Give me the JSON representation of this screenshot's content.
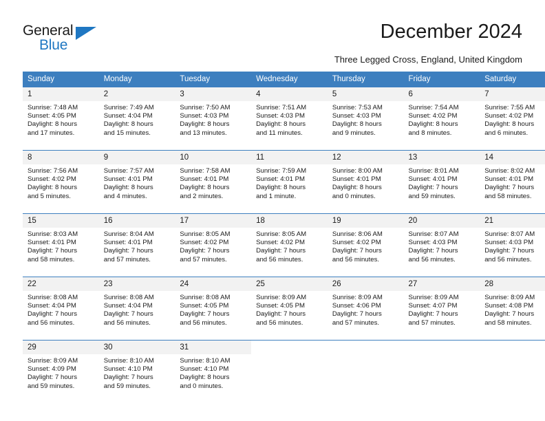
{
  "brand": {
    "name_top": "General",
    "name_bottom": "Blue",
    "accent_color": "#1f77c2"
  },
  "header": {
    "title": "December 2024",
    "subtitle": "Three Legged Cross, England, United Kingdom"
  },
  "theme": {
    "header_bg": "#3d7fbf",
    "header_text": "#ffffff",
    "daynum_bg": "#f2f2f2",
    "cell_bg": "#ffffff",
    "text": "#1a1a1a"
  },
  "weekdays": [
    "Sunday",
    "Monday",
    "Tuesday",
    "Wednesday",
    "Thursday",
    "Friday",
    "Saturday"
  ],
  "weeks": [
    [
      {
        "day": "1",
        "sunrise": "Sunrise: 7:48 AM",
        "sunset": "Sunset: 4:05 PM",
        "daylight_line1": "Daylight: 8 hours",
        "daylight_line2": "and 17 minutes."
      },
      {
        "day": "2",
        "sunrise": "Sunrise: 7:49 AM",
        "sunset": "Sunset: 4:04 PM",
        "daylight_line1": "Daylight: 8 hours",
        "daylight_line2": "and 15 minutes."
      },
      {
        "day": "3",
        "sunrise": "Sunrise: 7:50 AM",
        "sunset": "Sunset: 4:03 PM",
        "daylight_line1": "Daylight: 8 hours",
        "daylight_line2": "and 13 minutes."
      },
      {
        "day": "4",
        "sunrise": "Sunrise: 7:51 AM",
        "sunset": "Sunset: 4:03 PM",
        "daylight_line1": "Daylight: 8 hours",
        "daylight_line2": "and 11 minutes."
      },
      {
        "day": "5",
        "sunrise": "Sunrise: 7:53 AM",
        "sunset": "Sunset: 4:03 PM",
        "daylight_line1": "Daylight: 8 hours",
        "daylight_line2": "and 9 minutes."
      },
      {
        "day": "6",
        "sunrise": "Sunrise: 7:54 AM",
        "sunset": "Sunset: 4:02 PM",
        "daylight_line1": "Daylight: 8 hours",
        "daylight_line2": "and 8 minutes."
      },
      {
        "day": "7",
        "sunrise": "Sunrise: 7:55 AM",
        "sunset": "Sunset: 4:02 PM",
        "daylight_line1": "Daylight: 8 hours",
        "daylight_line2": "and 6 minutes."
      }
    ],
    [
      {
        "day": "8",
        "sunrise": "Sunrise: 7:56 AM",
        "sunset": "Sunset: 4:02 PM",
        "daylight_line1": "Daylight: 8 hours",
        "daylight_line2": "and 5 minutes."
      },
      {
        "day": "9",
        "sunrise": "Sunrise: 7:57 AM",
        "sunset": "Sunset: 4:01 PM",
        "daylight_line1": "Daylight: 8 hours",
        "daylight_line2": "and 4 minutes."
      },
      {
        "day": "10",
        "sunrise": "Sunrise: 7:58 AM",
        "sunset": "Sunset: 4:01 PM",
        "daylight_line1": "Daylight: 8 hours",
        "daylight_line2": "and 2 minutes."
      },
      {
        "day": "11",
        "sunrise": "Sunrise: 7:59 AM",
        "sunset": "Sunset: 4:01 PM",
        "daylight_line1": "Daylight: 8 hours",
        "daylight_line2": "and 1 minute."
      },
      {
        "day": "12",
        "sunrise": "Sunrise: 8:00 AM",
        "sunset": "Sunset: 4:01 PM",
        "daylight_line1": "Daylight: 8 hours",
        "daylight_line2": "and 0 minutes."
      },
      {
        "day": "13",
        "sunrise": "Sunrise: 8:01 AM",
        "sunset": "Sunset: 4:01 PM",
        "daylight_line1": "Daylight: 7 hours",
        "daylight_line2": "and 59 minutes."
      },
      {
        "day": "14",
        "sunrise": "Sunrise: 8:02 AM",
        "sunset": "Sunset: 4:01 PM",
        "daylight_line1": "Daylight: 7 hours",
        "daylight_line2": "and 58 minutes."
      }
    ],
    [
      {
        "day": "15",
        "sunrise": "Sunrise: 8:03 AM",
        "sunset": "Sunset: 4:01 PM",
        "daylight_line1": "Daylight: 7 hours",
        "daylight_line2": "and 58 minutes."
      },
      {
        "day": "16",
        "sunrise": "Sunrise: 8:04 AM",
        "sunset": "Sunset: 4:01 PM",
        "daylight_line1": "Daylight: 7 hours",
        "daylight_line2": "and 57 minutes."
      },
      {
        "day": "17",
        "sunrise": "Sunrise: 8:05 AM",
        "sunset": "Sunset: 4:02 PM",
        "daylight_line1": "Daylight: 7 hours",
        "daylight_line2": "and 57 minutes."
      },
      {
        "day": "18",
        "sunrise": "Sunrise: 8:05 AM",
        "sunset": "Sunset: 4:02 PM",
        "daylight_line1": "Daylight: 7 hours",
        "daylight_line2": "and 56 minutes."
      },
      {
        "day": "19",
        "sunrise": "Sunrise: 8:06 AM",
        "sunset": "Sunset: 4:02 PM",
        "daylight_line1": "Daylight: 7 hours",
        "daylight_line2": "and 56 minutes."
      },
      {
        "day": "20",
        "sunrise": "Sunrise: 8:07 AM",
        "sunset": "Sunset: 4:03 PM",
        "daylight_line1": "Daylight: 7 hours",
        "daylight_line2": "and 56 minutes."
      },
      {
        "day": "21",
        "sunrise": "Sunrise: 8:07 AM",
        "sunset": "Sunset: 4:03 PM",
        "daylight_line1": "Daylight: 7 hours",
        "daylight_line2": "and 56 minutes."
      }
    ],
    [
      {
        "day": "22",
        "sunrise": "Sunrise: 8:08 AM",
        "sunset": "Sunset: 4:04 PM",
        "daylight_line1": "Daylight: 7 hours",
        "daylight_line2": "and 56 minutes."
      },
      {
        "day": "23",
        "sunrise": "Sunrise: 8:08 AM",
        "sunset": "Sunset: 4:04 PM",
        "daylight_line1": "Daylight: 7 hours",
        "daylight_line2": "and 56 minutes."
      },
      {
        "day": "24",
        "sunrise": "Sunrise: 8:08 AM",
        "sunset": "Sunset: 4:05 PM",
        "daylight_line1": "Daylight: 7 hours",
        "daylight_line2": "and 56 minutes."
      },
      {
        "day": "25",
        "sunrise": "Sunrise: 8:09 AM",
        "sunset": "Sunset: 4:05 PM",
        "daylight_line1": "Daylight: 7 hours",
        "daylight_line2": "and 56 minutes."
      },
      {
        "day": "26",
        "sunrise": "Sunrise: 8:09 AM",
        "sunset": "Sunset: 4:06 PM",
        "daylight_line1": "Daylight: 7 hours",
        "daylight_line2": "and 57 minutes."
      },
      {
        "day": "27",
        "sunrise": "Sunrise: 8:09 AM",
        "sunset": "Sunset: 4:07 PM",
        "daylight_line1": "Daylight: 7 hours",
        "daylight_line2": "and 57 minutes."
      },
      {
        "day": "28",
        "sunrise": "Sunrise: 8:09 AM",
        "sunset": "Sunset: 4:08 PM",
        "daylight_line1": "Daylight: 7 hours",
        "daylight_line2": "and 58 minutes."
      }
    ],
    [
      {
        "day": "29",
        "sunrise": "Sunrise: 8:09 AM",
        "sunset": "Sunset: 4:09 PM",
        "daylight_line1": "Daylight: 7 hours",
        "daylight_line2": "and 59 minutes."
      },
      {
        "day": "30",
        "sunrise": "Sunrise: 8:10 AM",
        "sunset": "Sunset: 4:10 PM",
        "daylight_line1": "Daylight: 7 hours",
        "daylight_line2": "and 59 minutes."
      },
      {
        "day": "31",
        "sunrise": "Sunrise: 8:10 AM",
        "sunset": "Sunset: 4:10 PM",
        "daylight_line1": "Daylight: 8 hours",
        "daylight_line2": "and 0 minutes."
      },
      {
        "day": "",
        "sunrise": "",
        "sunset": "",
        "daylight_line1": "",
        "daylight_line2": ""
      },
      {
        "day": "",
        "sunrise": "",
        "sunset": "",
        "daylight_line1": "",
        "daylight_line2": ""
      },
      {
        "day": "",
        "sunrise": "",
        "sunset": "",
        "daylight_line1": "",
        "daylight_line2": ""
      },
      {
        "day": "",
        "sunrise": "",
        "sunset": "",
        "daylight_line1": "",
        "daylight_line2": ""
      }
    ]
  ]
}
